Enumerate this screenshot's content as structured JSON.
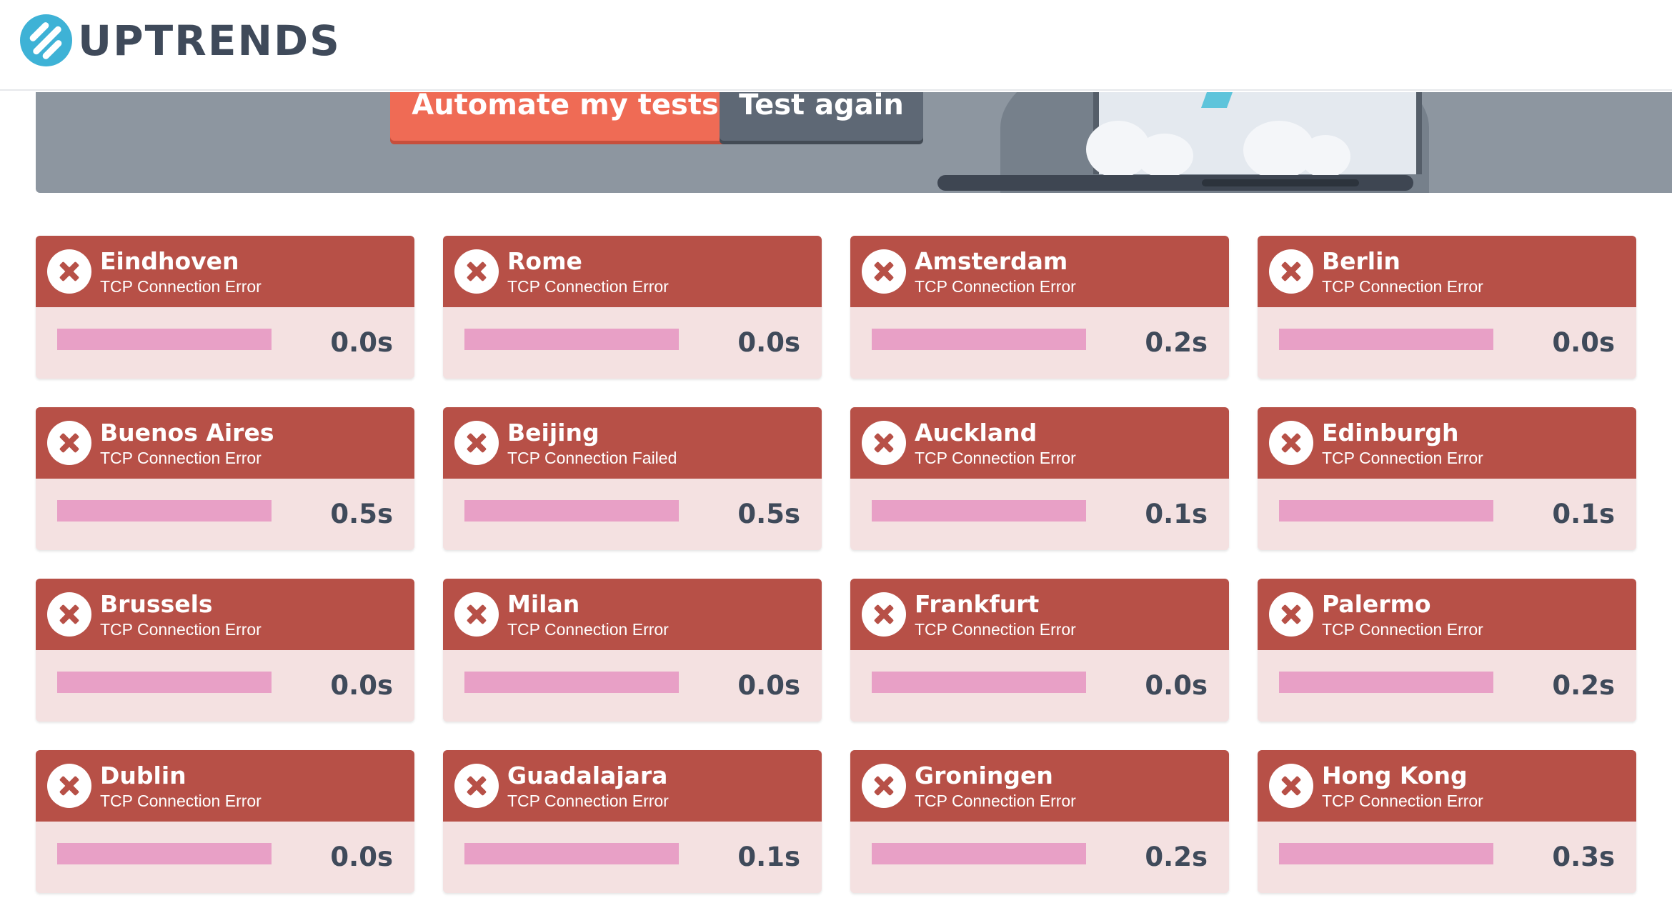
{
  "app": {
    "logo_text": "UPTRENDS"
  },
  "banner": {
    "automate_label": "Automate my tests",
    "test_again_label": "Test again"
  },
  "colors": {
    "error_header": "#b75047",
    "card_body": "#f4e1e1",
    "bar": "#e8a0c6",
    "automate_button": "#ef6b55",
    "test_button": "#5e6875",
    "logo": "#3eb2d6"
  },
  "results": [
    {
      "city": "Eindhoven",
      "status": "TCP Connection Error",
      "time": "0.0s",
      "bar_fraction": 1.0,
      "icon": "error-x-icon"
    },
    {
      "city": "Rome",
      "status": "TCP Connection Error",
      "time": "0.0s",
      "bar_fraction": 1.0,
      "icon": "error-x-icon"
    },
    {
      "city": "Amsterdam",
      "status": "TCP Connection Error",
      "time": "0.2s",
      "bar_fraction": 1.0,
      "icon": "error-x-icon"
    },
    {
      "city": "Berlin",
      "status": "TCP Connection Error",
      "time": "0.0s",
      "bar_fraction": 1.0,
      "icon": "error-x-icon"
    },
    {
      "city": "Buenos Aires",
      "status": "TCP Connection Error",
      "time": "0.5s",
      "bar_fraction": 1.0,
      "icon": "error-x-icon"
    },
    {
      "city": "Beijing",
      "status": "TCP Connection Failed",
      "time": "0.5s",
      "bar_fraction": 1.0,
      "icon": "error-x-icon"
    },
    {
      "city": "Auckland",
      "status": "TCP Connection Error",
      "time": "0.1s",
      "bar_fraction": 1.0,
      "icon": "error-x-icon"
    },
    {
      "city": "Edinburgh",
      "status": "TCP Connection Error",
      "time": "0.1s",
      "bar_fraction": 1.0,
      "icon": "error-x-icon"
    },
    {
      "city": "Brussels",
      "status": "TCP Connection Error",
      "time": "0.0s",
      "bar_fraction": 1.0,
      "icon": "error-x-icon"
    },
    {
      "city": "Milan",
      "status": "TCP Connection Error",
      "time": "0.0s",
      "bar_fraction": 1.0,
      "icon": "error-x-icon"
    },
    {
      "city": "Frankfurt",
      "status": "TCP Connection Error",
      "time": "0.0s",
      "bar_fraction": 1.0,
      "icon": "error-x-icon"
    },
    {
      "city": "Palermo",
      "status": "TCP Connection Error",
      "time": "0.2s",
      "bar_fraction": 1.0,
      "icon": "error-x-icon"
    },
    {
      "city": "Dublin",
      "status": "TCP Connection Error",
      "time": "0.0s",
      "bar_fraction": 1.0,
      "icon": "error-x-icon"
    },
    {
      "city": "Guadalajara",
      "status": "TCP Connection Error",
      "time": "0.1s",
      "bar_fraction": 1.0,
      "icon": "error-x-icon"
    },
    {
      "city": "Groningen",
      "status": "TCP Connection Error",
      "time": "0.2s",
      "bar_fraction": 1.0,
      "icon": "error-x-icon"
    },
    {
      "city": "Hong Kong",
      "status": "TCP Connection Error",
      "time": "0.3s",
      "bar_fraction": 1.0,
      "icon": "error-x-icon"
    }
  ]
}
